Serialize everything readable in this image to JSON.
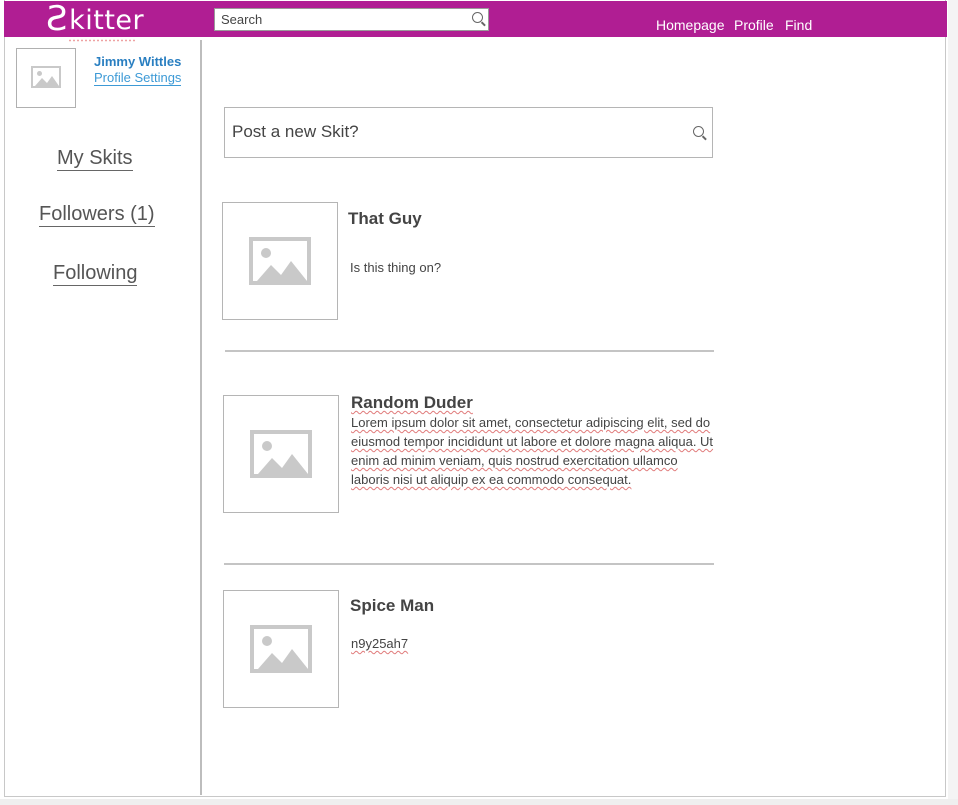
{
  "app": {
    "logo_mark": "Ƨ",
    "logo_text": "kitter"
  },
  "search": {
    "placeholder": "Search"
  },
  "nav": {
    "homepage": "Homepage",
    "profile": "Profile",
    "find": "Find"
  },
  "user": {
    "name": "Jimmy Wittles",
    "settings_link": "Profile Settings"
  },
  "sidebar": {
    "items": [
      {
        "label": "My Skits"
      },
      {
        "label": "Followers (1)"
      },
      {
        "label": "Following"
      }
    ]
  },
  "composer": {
    "placeholder": "Post a new Skit?"
  },
  "skits": [
    {
      "author": "That Guy",
      "text": "Is this thing on?"
    },
    {
      "author": "Random Duder",
      "text": "Lorem ipsum dolor sit amet, consectetur adipiscing elit, sed do eiusmod tempor incididunt ut labore et dolore magna aliqua. Ut enim ad minim veniam, quis nostrud exercitation ullamco laboris nisi ut aliquip ex ea commodo consequat."
    },
    {
      "author": "Spice Man",
      "text": "n9y25ah7"
    }
  ],
  "colors": {
    "brand": "#b01e93",
    "link": "#2a7fc1"
  },
  "icons": {
    "search": "search-icon",
    "placeholder_image": "image-placeholder-icon"
  }
}
